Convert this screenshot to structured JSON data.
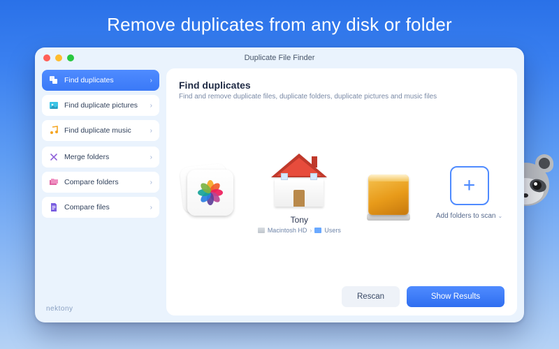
{
  "hero": {
    "title": "Remove duplicates from any disk or folder"
  },
  "window": {
    "title": "Duplicate File Finder"
  },
  "sidebar": {
    "group1": [
      {
        "label": "Find duplicates",
        "icon": "duplicates-icon"
      },
      {
        "label": "Find duplicate pictures",
        "icon": "picture-icon"
      },
      {
        "label": "Find duplicate music",
        "icon": "music-icon"
      }
    ],
    "group2": [
      {
        "label": "Merge folders",
        "icon": "merge-icon"
      },
      {
        "label": "Compare folders",
        "icon": "folders-icon"
      },
      {
        "label": "Compare files",
        "icon": "file-icon"
      }
    ],
    "brand": "nektony"
  },
  "panel": {
    "title": "Find duplicates",
    "subtitle": "Find and remove duplicate files, duplicate folders, duplicate pictures and music files",
    "home": {
      "label": "Tony",
      "disk": "Macintosh HD",
      "folder": "Users"
    },
    "add": {
      "label": "Add folders to scan"
    }
  },
  "footer": {
    "rescan": "Rescan",
    "show": "Show Results"
  },
  "colors": {
    "petals": [
      "#f6a623",
      "#f15a29",
      "#ed1c5b",
      "#b84592",
      "#5c4099",
      "#2a7de1",
      "#17a398",
      "#7cb342"
    ]
  }
}
